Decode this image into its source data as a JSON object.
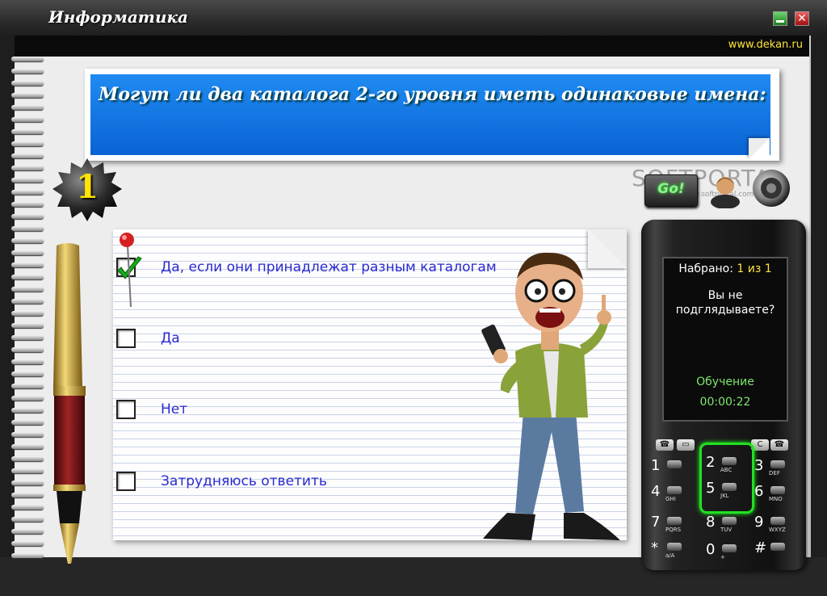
{
  "window": {
    "title": "Информатика",
    "site_link": "www.dekan.ru",
    "close_glyph": "✕"
  },
  "question": {
    "number": "1",
    "text": "Могут ли два каталога 2-го уровня иметь одинаковые имена:"
  },
  "answers": [
    {
      "label": "Да, если они принадлежат разным каталогам",
      "checked": true
    },
    {
      "label": "Да",
      "checked": false
    },
    {
      "label": "Нет",
      "checked": false
    },
    {
      "label": "Затрудняюсь ответить",
      "checked": false
    }
  ],
  "controls": {
    "go_label": "Go!",
    "helper_icon": "person-bust-icon",
    "sound_icon": "speaker-icon"
  },
  "watermark": {
    "text": "SOFTPORTAL",
    "sub": "www.softportal.com"
  },
  "phone": {
    "dialed_label": "Набрано:",
    "dialed_value": "1 из 1",
    "message_line1": "Вы не",
    "message_line2": "подглядываете?",
    "mode": "Обучение",
    "timer": "00:00:22",
    "keys": [
      {
        "num": "1",
        "sub": ""
      },
      {
        "num": "2",
        "sub": "ABC"
      },
      {
        "num": "3",
        "sub": "DEF"
      },
      {
        "num": "4",
        "sub": "GHI"
      },
      {
        "num": "5",
        "sub": "JKL"
      },
      {
        "num": "6",
        "sub": "MNO"
      },
      {
        "num": "7",
        "sub": "PQRS"
      },
      {
        "num": "8",
        "sub": "TUV"
      },
      {
        "num": "9",
        "sub": "WXYZ"
      },
      {
        "num": "*",
        "sub": "a/A"
      },
      {
        "num": "0",
        "sub": "+"
      },
      {
        "num": "#",
        "sub": ""
      }
    ],
    "clear_label": "C"
  },
  "colors": {
    "question_bg": "#0a63d4",
    "answer_text": "#2a2ad0",
    "phone_accent": "#22e022",
    "highlight": "#ffe23a"
  }
}
